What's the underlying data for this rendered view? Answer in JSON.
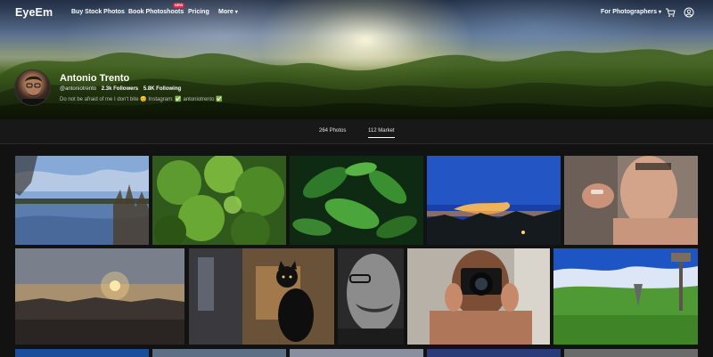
{
  "nav": {
    "logo": "EyeEm",
    "links": [
      "Buy Stock Photos",
      "Book Photoshoots",
      "Pricing",
      "More"
    ],
    "new_badge": "NEW",
    "for_photographers": "For Photographers"
  },
  "icons": {
    "cart": "cart-icon",
    "user": "user-icon",
    "chevron": "chevron-down-icon"
  },
  "profile": {
    "name": "Antonio Trento",
    "handle": "@antoniotrento",
    "followers": "2.3k Followers",
    "following": "5.8K Following",
    "bio": "Do not be afraid of me I don't bite 😊 Instagram: ✅ antoniotrento ✅"
  },
  "tabs": [
    {
      "label": "264 Photos",
      "active": false
    },
    {
      "label": "112 Market",
      "active": true
    }
  ],
  "colors": {
    "background": "#121212",
    "badge": "#e8254a",
    "accent_green": "#39c34a"
  }
}
